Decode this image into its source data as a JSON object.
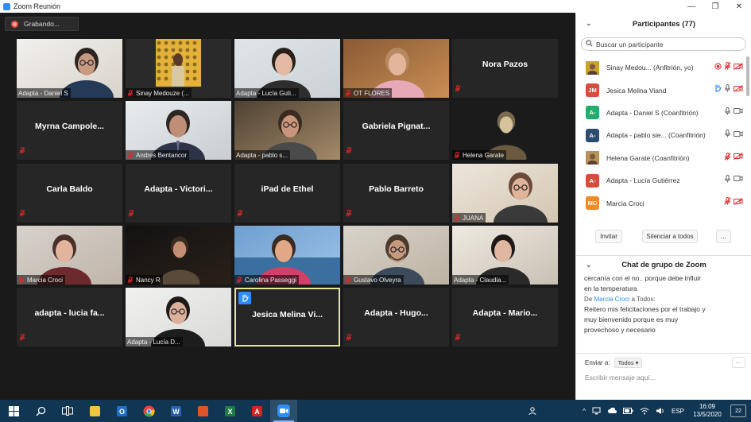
{
  "window": {
    "title": "Zoom Reunión",
    "controls": {
      "minimize": "—",
      "maximize": "❐",
      "close": "✕"
    }
  },
  "recording": {
    "label": "Grabando..."
  },
  "tiles": [
    {
      "name": "Adapta - Daniel S",
      "kind": "video",
      "scene": "daniel"
    },
    {
      "name": "Sinay Medouze (...",
      "kind": "video",
      "scene": "sinay",
      "muted": true
    },
    {
      "name": "Adapta - Lucía Guti...",
      "kind": "video",
      "scene": "lucia"
    },
    {
      "name": "OT FLORES",
      "kind": "video",
      "scene": "flores",
      "muted": true
    },
    {
      "name": "Nora Pazos",
      "kind": "name",
      "muted": true
    },
    {
      "name": "Myrna  Campole...",
      "kind": "name",
      "muted": true
    },
    {
      "name": "Andres Bentancor",
      "kind": "video",
      "scene": "andres",
      "muted": true
    },
    {
      "name": "Adapta - pablo s...",
      "kind": "video",
      "scene": "pablo"
    },
    {
      "name": "Gabriela  Pignat...",
      "kind": "name",
      "muted": true
    },
    {
      "name": "Helena Garate",
      "kind": "video",
      "scene": "helena",
      "muted": true
    },
    {
      "name": "Carla Baldo",
      "kind": "name",
      "muted": true
    },
    {
      "name": "Adapta  -  Victori...",
      "kind": "name",
      "muted": true
    },
    {
      "name": "iPad de Ethel",
      "kind": "name",
      "muted": true
    },
    {
      "name": "Pablo Barreto",
      "kind": "name",
      "muted": true
    },
    {
      "name": "JUANA",
      "kind": "video",
      "scene": "juana",
      "muted": true
    },
    {
      "name": "Marcia Croci",
      "kind": "video",
      "scene": "marcia",
      "muted": true
    },
    {
      "name": "Nancy R",
      "kind": "video",
      "scene": "nancy",
      "muted": true
    },
    {
      "name": "Carolina Passeggi",
      "kind": "video",
      "scene": "carolina",
      "muted": true
    },
    {
      "name": "Gustavo Olveyra",
      "kind": "video",
      "scene": "gustavo",
      "muted": true
    },
    {
      "name": "Adapta - Claudia...",
      "kind": "video",
      "scene": "claudia"
    },
    {
      "name": "adapta  -  lucia  fa...",
      "kind": "name",
      "muted": true
    },
    {
      "name": "Adapta - Lucía D...",
      "kind": "video",
      "scene": "luciad"
    },
    {
      "name": "Jesica  Melina  Vi...",
      "kind": "name",
      "active": true,
      "hand": true
    },
    {
      "name": "Adapta  -  Hugo...",
      "kind": "name",
      "muted": true
    },
    {
      "name": "Adapta  -  Mario...",
      "kind": "name",
      "muted": true
    }
  ],
  "participants": {
    "title": "Participantes (77)",
    "search_placeholder": "Buscar un participante",
    "list": [
      {
        "name": "Sinay Medou...  (Anfitrión, yo)",
        "avatar": "",
        "avatar_color": "#c9a227",
        "photo": true,
        "mic": "muted",
        "video": "off",
        "rec": true
      },
      {
        "name": "Jesica Melina Viand",
        "avatar": "JM",
        "avatar_color": "#d94c3d",
        "hand": true,
        "mic": "on",
        "video": "off"
      },
      {
        "name": "Adapta - Daniel S (Coanfitrión)",
        "avatar": "A-",
        "avatar_color": "#1fae6b",
        "mic": "on",
        "video": "on"
      },
      {
        "name": "Adapta - pablo sie... (Coanfitrión)",
        "avatar": "A-",
        "avatar_color": "#2d4d6e",
        "mic": "on",
        "video": "on"
      },
      {
        "name": "Helena Garate (Coanfitrión)",
        "avatar": "",
        "avatar_color": "#b9925a",
        "photo": true,
        "mic": "muted",
        "video": "off"
      },
      {
        "name": "Adapta - Lucía Gutiérrez",
        "avatar": "A-",
        "avatar_color": "#d94c3d",
        "mic": "on",
        "video": "on"
      },
      {
        "name": "Marcia Croci",
        "avatar": "MC",
        "avatar_color": "#f08a24",
        "mic": "muted",
        "video": "off"
      }
    ],
    "invite": "Invitar",
    "mute_all": "Silenciar a todos",
    "more": "..."
  },
  "chat": {
    "title": "Chat de grupo de Zoom",
    "line1": "cercanía con el no.. porque debe influir",
    "line2": "en la temperatura",
    "from_prefix": "De",
    "from_name": "Marcia Croci",
    "from_suffix": "a Todos:",
    "msg1": "Reitero mis felicitaciones por el trabajo y",
    "msg2": "muy bienvenido porque es muy",
    "msg3": "provechoso y necesario",
    "send_to_label": "Enviar a:",
    "send_to_value": "Todos ▾",
    "placeholder": "Escribir mensaje aquí..."
  },
  "taskbar": {
    "lang": "ESP",
    "time": "16:09",
    "date": "13/5/2020",
    "notifications": "22",
    "icons": [
      "windows-start",
      "search",
      "task-view",
      "file-explorer",
      "outlook",
      "chrome",
      "word",
      "office",
      "excel",
      "acrobat",
      "zoom"
    ]
  },
  "colors": {
    "meeting_bg": "#1a1a1a",
    "tile_bg": "#262626",
    "active_border": "#e5e99a",
    "zoom_blue": "#2d8cff",
    "muted_red": "#e02828",
    "taskbar_bg": "#103654"
  }
}
